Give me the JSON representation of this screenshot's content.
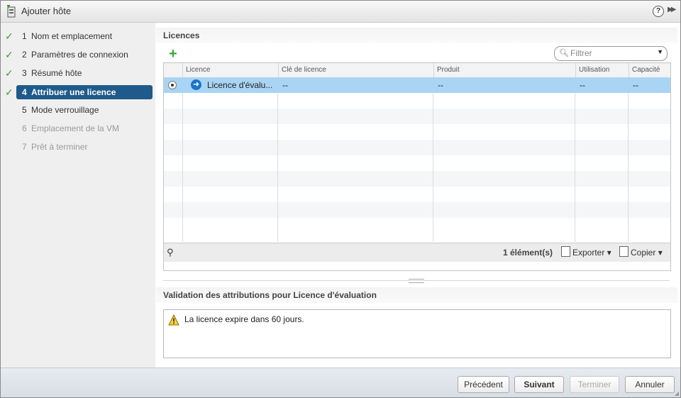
{
  "dialog": {
    "title": "Ajouter hôte",
    "help_symbol": "?",
    "expand_symbol": "▶▶"
  },
  "steps": [
    {
      "num": "1",
      "label": "Nom et emplacement",
      "state": "done"
    },
    {
      "num": "2",
      "label": "Paramètres de connexion",
      "state": "done"
    },
    {
      "num": "3",
      "label": "Résumé hôte",
      "state": "done"
    },
    {
      "num": "4",
      "label": "Attribuer une licence",
      "state": "active"
    },
    {
      "num": "5",
      "label": "Mode verrouillage",
      "state": "pending"
    },
    {
      "num": "6",
      "label": "Emplacement de la VM",
      "state": "disabled"
    },
    {
      "num": "7",
      "label": "Prêt à terminer",
      "state": "disabled"
    }
  ],
  "licences": {
    "header": "Licences",
    "filter_placeholder": "Filtrer",
    "columns": [
      "Licence",
      "Clé de licence",
      "Produit",
      "Utilisation",
      "Capacité"
    ],
    "rows": [
      {
        "licence": "Licence d'évalu...",
        "key": "--",
        "product": "--",
        "usage": "--",
        "capacity": "--",
        "selected": true
      }
    ],
    "count": "1 élément(s)",
    "export_label": "Exporter",
    "copy_label": "Copier"
  },
  "validation": {
    "header": "Validation des attributions pour Licence d'évaluation",
    "message": "La licence expire dans 60 jours."
  },
  "footer": {
    "previous": "Précédent",
    "next": "Suivant",
    "finish": "Terminer",
    "cancel": "Annuler"
  },
  "colors": {
    "active_step": "#1f5a8a",
    "selected_row": "#a9d4f4",
    "check": "#3c9a2e",
    "add_icon": "#3aa63a"
  },
  "icons": {
    "title": "host-add-icon",
    "add": "plus-icon",
    "filter": "search-icon",
    "row": "arrow-right-circle-icon",
    "footer_search": "binoculars-icon",
    "export": "export-icon",
    "copy": "copy-icon",
    "warning": "warning-triangle-icon"
  }
}
